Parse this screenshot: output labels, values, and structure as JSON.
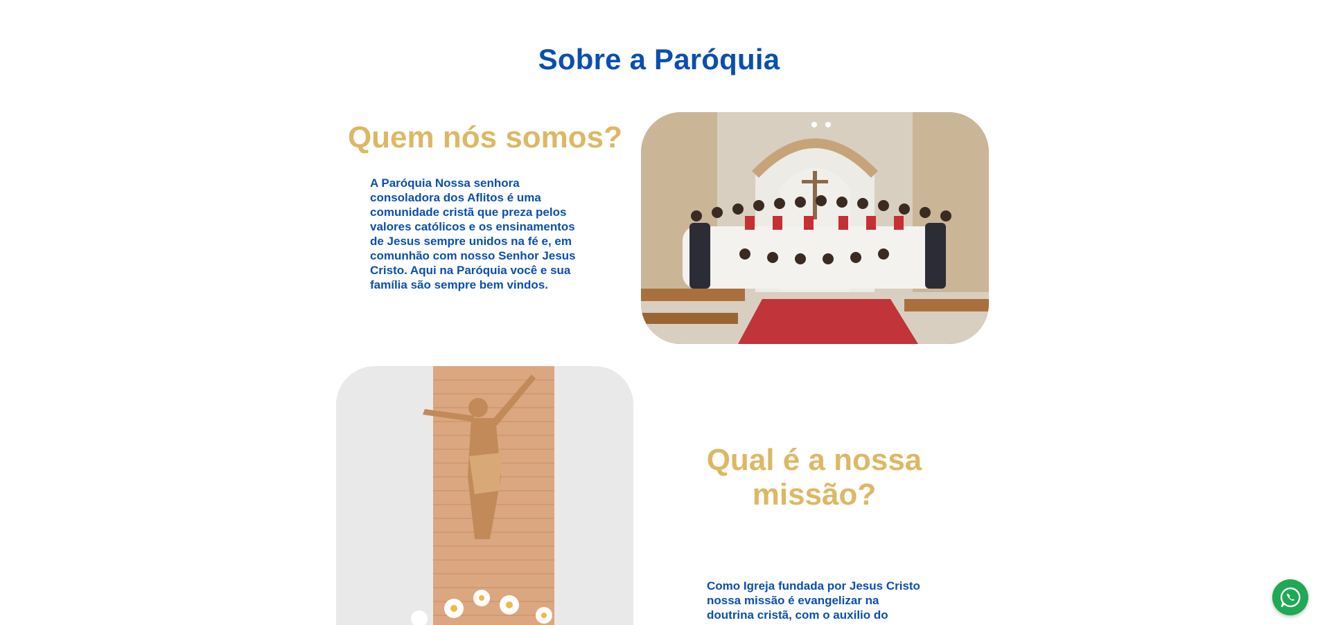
{
  "about": {
    "title": "Sobre a Paróquia"
  },
  "who": {
    "title": "Quem nós somos?",
    "text": "A Paróquia Nossa senhora consoladora dos Aflitos é uma comunidade cristã que preza pelos valores católicos e os ensinamentos de Jesus sempre unidos na fé e, em comunhão com nosso Senhor Jesus Cristo. Aqui na Paróquia você e sua família são sempre bem vindos."
  },
  "mission": {
    "title": "Qual é a nossa missão?",
    "text": "Como Igreja fundada por Jesus Cristo nossa missão é evangelizar na doutrina cristã, com o auxilio do"
  },
  "images": {
    "group_photo": "parish-group-photo",
    "crucifix_photo": "crucifix-photo"
  },
  "floating": {
    "whatsapp_icon": "whatsapp-icon"
  },
  "colors": {
    "primary_blue": "#0a4fae",
    "gold": "#ddb864",
    "whatsapp_green": "#1fa855"
  }
}
